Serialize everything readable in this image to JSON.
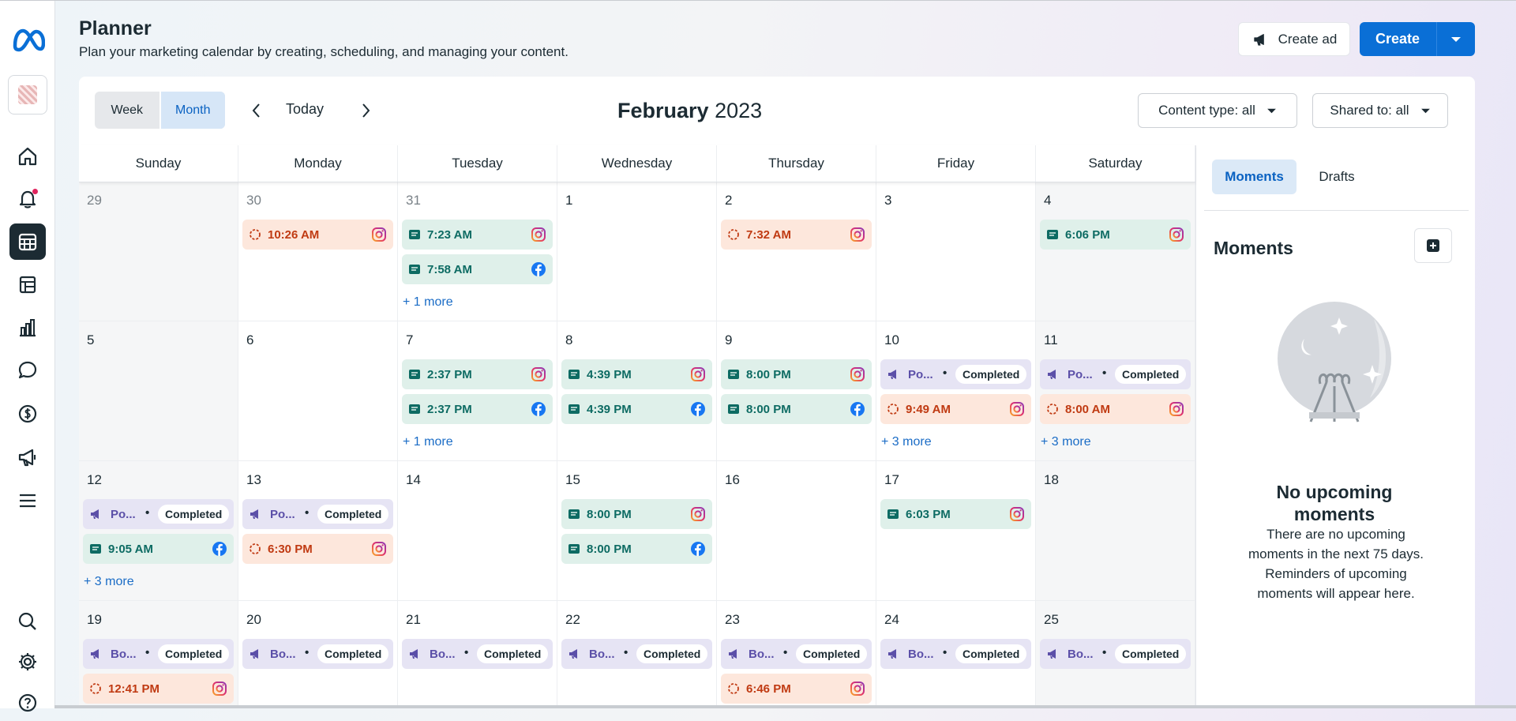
{
  "header": {
    "title": "Planner",
    "subtitle": "Plan your marketing calendar by creating, scheduling, and managing your content.",
    "create_ad_label": "Create ad",
    "create_label": "Create"
  },
  "rail": {
    "items": [
      "home-icon",
      "notifications-icon",
      "planner-icon",
      "content-icon",
      "insights-icon",
      "inbox-icon",
      "monetization-icon",
      "ads-icon",
      "menu-icon",
      "search-icon",
      "settings-icon",
      "help-icon"
    ]
  },
  "toolbar": {
    "week_label": "Week",
    "month_label": "Month",
    "today_label": "Today",
    "month_title_month": "February",
    "month_title_year": "2023",
    "content_type_label": "Content type: all",
    "shared_to_label": "Shared to: all"
  },
  "weekdays": [
    "Sunday",
    "Monday",
    "Tuesday",
    "Wednesday",
    "Thursday",
    "Friday",
    "Saturday"
  ],
  "weeks": [
    [
      {
        "date": "29",
        "muted": true,
        "events": []
      },
      {
        "date": "30",
        "muted": true,
        "events": [
          {
            "kind": "story",
            "time": "10:26 AM",
            "platform": "instagram"
          }
        ]
      },
      {
        "date": "31",
        "muted": true,
        "events": [
          {
            "kind": "post",
            "time": "7:23 AM",
            "platform": "instagram"
          },
          {
            "kind": "post",
            "time": "7:58 AM",
            "platform": "facebook"
          }
        ],
        "more": "+ 1 more"
      },
      {
        "date": "1",
        "events": []
      },
      {
        "date": "2",
        "events": [
          {
            "kind": "story",
            "time": "7:32 AM",
            "platform": "instagram"
          }
        ]
      },
      {
        "date": "3",
        "events": []
      },
      {
        "date": "4",
        "events": [
          {
            "kind": "post",
            "time": "6:06 PM",
            "platform": "instagram"
          }
        ]
      }
    ],
    [
      {
        "date": "5",
        "events": []
      },
      {
        "date": "6",
        "events": []
      },
      {
        "date": "7",
        "events": [
          {
            "kind": "post",
            "time": "2:37 PM",
            "platform": "instagram"
          },
          {
            "kind": "post",
            "time": "2:37 PM",
            "platform": "facebook"
          }
        ],
        "more": "+ 1 more"
      },
      {
        "date": "8",
        "events": [
          {
            "kind": "post",
            "time": "4:39 PM",
            "platform": "instagram"
          },
          {
            "kind": "post",
            "time": "4:39 PM",
            "platform": "facebook"
          }
        ]
      },
      {
        "date": "9",
        "events": [
          {
            "kind": "post",
            "time": "8:00 PM",
            "platform": "instagram"
          },
          {
            "kind": "post",
            "time": "8:00 PM",
            "platform": "facebook"
          }
        ]
      },
      {
        "date": "10",
        "events": [
          {
            "kind": "boost",
            "name": "Po...",
            "status": "Completed"
          },
          {
            "kind": "story",
            "time": "9:49 AM",
            "platform": "instagram"
          }
        ],
        "more": "+ 3 more"
      },
      {
        "date": "11",
        "events": [
          {
            "kind": "boost",
            "name": "Po...",
            "status": "Completed"
          },
          {
            "kind": "story",
            "time": "8:00 AM",
            "platform": "instagram"
          }
        ],
        "more": "+ 3 more"
      }
    ],
    [
      {
        "date": "12",
        "events": [
          {
            "kind": "boost",
            "name": "Po...",
            "status": "Completed"
          },
          {
            "kind": "post",
            "time": "9:05 AM",
            "platform": "facebook"
          }
        ],
        "more": "+ 3 more"
      },
      {
        "date": "13",
        "events": [
          {
            "kind": "boost",
            "name": "Po...",
            "status": "Completed"
          },
          {
            "kind": "story",
            "time": "6:30 PM",
            "platform": "instagram"
          }
        ]
      },
      {
        "date": "14",
        "events": []
      },
      {
        "date": "15",
        "events": [
          {
            "kind": "post",
            "time": "8:00 PM",
            "platform": "instagram"
          },
          {
            "kind": "post",
            "time": "8:00 PM",
            "platform": "facebook"
          }
        ]
      },
      {
        "date": "16",
        "events": []
      },
      {
        "date": "17",
        "events": [
          {
            "kind": "post",
            "time": "6:03 PM",
            "platform": "instagram"
          }
        ]
      },
      {
        "date": "18",
        "events": []
      }
    ],
    [
      {
        "date": "19",
        "events": [
          {
            "kind": "boost",
            "name": "Bo...",
            "status": "Completed"
          },
          {
            "kind": "story",
            "time": "12:41 PM",
            "platform": "instagram"
          }
        ]
      },
      {
        "date": "20",
        "events": [
          {
            "kind": "boost",
            "name": "Bo...",
            "status": "Completed"
          }
        ]
      },
      {
        "date": "21",
        "events": [
          {
            "kind": "boost",
            "name": "Bo...",
            "status": "Completed"
          }
        ]
      },
      {
        "date": "22",
        "events": [
          {
            "kind": "boost",
            "name": "Bo...",
            "status": "Completed"
          }
        ]
      },
      {
        "date": "23",
        "events": [
          {
            "kind": "boost",
            "name": "Bo...",
            "status": "Completed"
          },
          {
            "kind": "story",
            "time": "6:46 PM",
            "platform": "instagram"
          }
        ]
      },
      {
        "date": "24",
        "events": [
          {
            "kind": "boost",
            "name": "Bo...",
            "status": "Completed"
          }
        ]
      },
      {
        "date": "25",
        "events": [
          {
            "kind": "boost",
            "name": "Bo...",
            "status": "Completed"
          }
        ]
      }
    ]
  ],
  "side": {
    "tab_moments": "Moments",
    "tab_drafts": "Drafts",
    "heading": "Moments",
    "empty_title": "No upcoming moments",
    "empty_text": "There are no upcoming moments in the next 75 days. Reminders of upcoming moments will appear here."
  },
  "colors": {
    "primary": "#0a6fd6",
    "post_bg": "#dff0ea",
    "story_bg": "#fde7dc",
    "boost_bg": "#e6e4f4"
  }
}
